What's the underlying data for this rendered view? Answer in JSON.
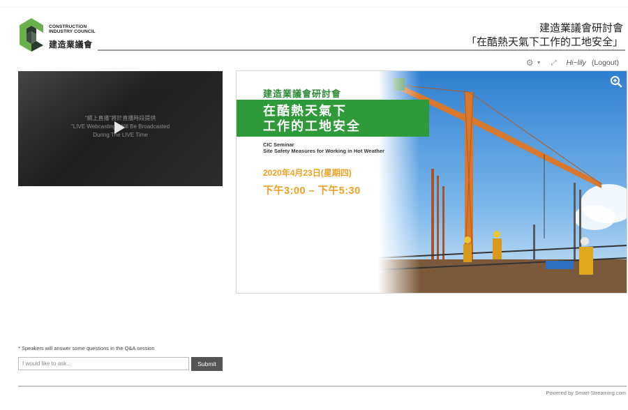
{
  "header": {
    "logo": {
      "en_lines": [
        "CONSTRUCTION",
        "INDUSTRY COUNCIL"
      ],
      "zh": "建造業議會",
      "colors": {
        "green": "#6ab04c",
        "dark": "#2b3a2e"
      }
    },
    "title_line1": "建造業議會研討會",
    "title_line2": "「在酷熱天氣下工作的工地安全」"
  },
  "utility": {
    "settings_icon": "gear-icon",
    "expand_icon": "expand-icon",
    "greeting": "Hi~lily",
    "logout_label": "(Logout)"
  },
  "video": {
    "message_zh": "\"網上直播\"將於直播時段提供",
    "message_en_1": "\"LIVE Webcasting\" Will Be Broadcasted",
    "message_en_2": "During The LIVE Time",
    "play_icon": "play-icon"
  },
  "slide": {
    "zh_title": "建造業議會研討會",
    "banner_line1": "在酷熱天氣下",
    "banner_line2": "工作的工地安全",
    "en_line1": "CIC Seminar",
    "en_line2": "Site Safety Measures for Working in Hot Weather",
    "date": "2020年4月23日(星期四)",
    "time": "下午3:00 – 下午5:30",
    "zoom_icon": "zoom-in-icon",
    "accent_green": "#2e9a3a",
    "accent_orange": "#f0a020"
  },
  "qa": {
    "note": "* Speakers will answer some questions in the Q&A session",
    "placeholder": "I would like to ask...",
    "value": "",
    "submit_label": "Submit"
  },
  "footer": {
    "powered_by": "Powered by Smart-Streaming.com"
  }
}
